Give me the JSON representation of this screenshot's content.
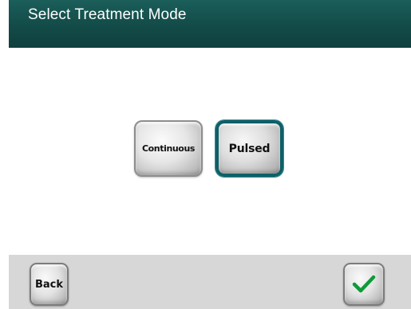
{
  "header": {
    "title": "Select Treatment Mode"
  },
  "modes": [
    {
      "label": "Continuous",
      "selected": false
    },
    {
      "label": "Pulsed",
      "selected": true
    }
  ],
  "footer": {
    "back_label": "Back",
    "confirm_icon": "checkmark-icon"
  },
  "colors": {
    "header_bg": "#134b48",
    "selected_border": "#0e5f67",
    "footer_bg": "#d7d7d7",
    "check_green": "#0f9a3a"
  }
}
